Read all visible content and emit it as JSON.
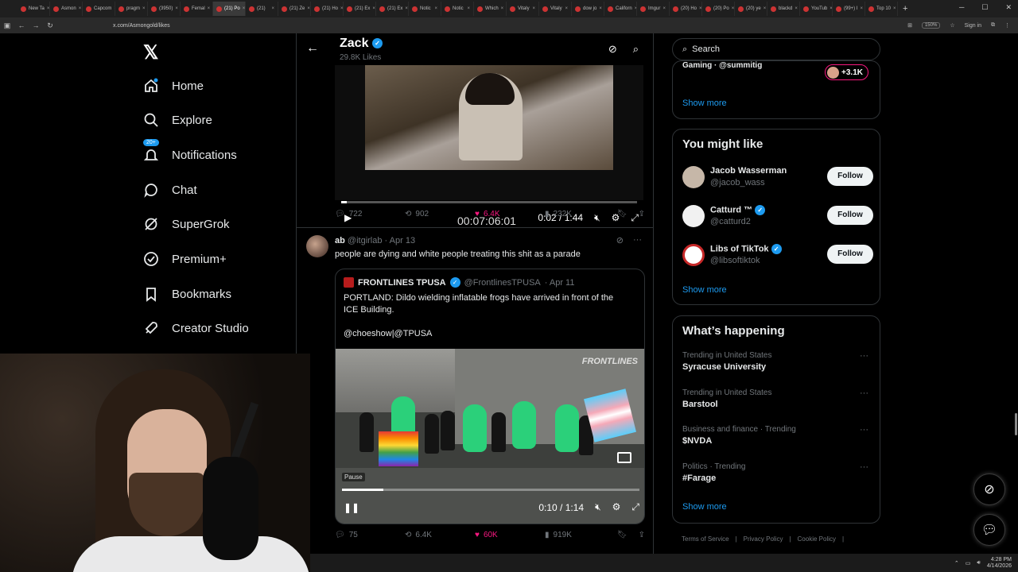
{
  "browser": {
    "tabs": [
      "New Ta",
      "Asmon",
      "Capcom",
      "pragm",
      "(3950)",
      "Femal",
      "(21) Po",
      "(21)",
      "(21) Ze",
      "(21) Ho",
      "(21) Ex",
      "(21) Ex",
      "Notic",
      "Notic",
      "Which",
      "Vitaly",
      "Vitaly",
      "dow jo",
      "Californ",
      "Imgur",
      "(20) Ho",
      "(20) Po",
      "(20) ye",
      "blackd",
      "YouTub",
      "(99+) I",
      "Top 10"
    ],
    "url": "x.com/Asmongold/likes",
    "zoom": "150%",
    "sign_in": "Sign in"
  },
  "nav": {
    "items": [
      {
        "label": "Home"
      },
      {
        "label": "Explore"
      },
      {
        "label": "Notifications"
      },
      {
        "label": "Chat"
      },
      {
        "label": "SuperGrok"
      },
      {
        "label": "Premium+"
      },
      {
        "label": "Bookmarks"
      },
      {
        "label": "Creator Studio"
      }
    ],
    "notif_badge": "20+"
  },
  "header": {
    "name": "Zack",
    "sub": "29.8K Likes"
  },
  "video1": {
    "overlay_timecode": "00:07:06:01",
    "time": "0:02 / 1:44",
    "progress": 0.02
  },
  "tweet1_actions": {
    "replies": "722",
    "reposts": "902",
    "likes": "6.4K",
    "views": "232K"
  },
  "tweet2": {
    "name": "ab",
    "handle": "@itgirlab",
    "date": "· Apr 13",
    "text": "people are dying and white people treating this shit as a parade"
  },
  "quote": {
    "name": "FRONTLINES TPUSA",
    "handle": "@FrontlinesTPUSA",
    "date": "· Apr 11",
    "text": "PORTLAND: Dildo wielding inflatable frogs have arrived in front of the\nICE Building.\n\n@choeshow|@TPUSA",
    "watermark": "FRONTLINES",
    "pause_label": "Pause",
    "time": "0:10 / 1:14",
    "progress": 0.14
  },
  "tweet2_actions": {
    "replies": "75",
    "reposts": "6.4K",
    "likes": "60K",
    "views": "919K"
  },
  "right": {
    "search_placeholder": "Search",
    "top_card": {
      "gaming_line": "Gaming · @summitig",
      "facepile_count": "+3.1K",
      "show_more": "Show more"
    },
    "you_might_like": {
      "title": "You might like",
      "users": [
        {
          "name": "Jacob Wasserman",
          "handle": "@jacob_wass",
          "follow": "Follow",
          "verified": false
        },
        {
          "name": "Catturd ™",
          "handle": "@catturd2",
          "follow": "Follow",
          "verified": true
        },
        {
          "name": "Libs of TikTok",
          "handle": "@libsoftiktok",
          "follow": "Follow",
          "verified": true
        }
      ],
      "show_more": "Show more"
    },
    "whats_happening": {
      "title": "What’s happening",
      "trends": [
        {
          "context": "Trending in United States",
          "title": "Syracuse University"
        },
        {
          "context": "Trending in United States",
          "title": "Barstool"
        },
        {
          "context": "Business and finance · Trending",
          "title": "$NVDA"
        },
        {
          "context": "Politics · Trending",
          "title": "#Farage"
        }
      ],
      "show_more": "Show more"
    },
    "footer": [
      "Terms of Service",
      "|",
      "Privacy Policy",
      "|",
      "Cookie Policy",
      "|"
    ]
  },
  "taskbar": {
    "time": "4:28 PM",
    "date": "4/14/2026"
  },
  "colors": {
    "accent": "#1d9bf0",
    "like": "#f91880",
    "muted": "#71767b",
    "border": "#2f3336"
  }
}
